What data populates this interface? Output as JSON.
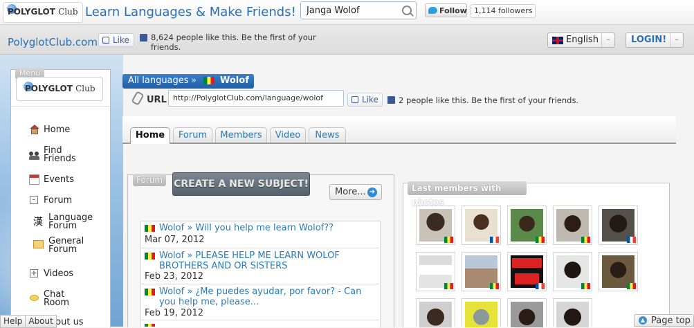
{
  "header": {
    "logo_text": "POLYGLOT",
    "logo_club": "Club",
    "tagline": "Learn Languages & Make Friends!",
    "search_value": "Janga Wolof",
    "follow_label": "Follow",
    "followers": "1,114 followers"
  },
  "subbar": {
    "site_name": "PolyglotClub.com",
    "like_label": "Like",
    "likes_text": "8,624 people like this. Be the first of your friends.",
    "language": "English",
    "login": "LOGIN!"
  },
  "menu": {
    "tab_label": "Menu",
    "logo_text": "POLYGLOT",
    "logo_club": "Club",
    "items": [
      {
        "label": "Home",
        "icon": "home-icon"
      },
      {
        "label": "Find Friends",
        "icon": "friends-icon"
      },
      {
        "label": "Events",
        "icon": "calendar-icon"
      },
      {
        "label": "Forum",
        "icon": "collapse-icon"
      },
      {
        "label": "Language Forum",
        "icon": "kanji-icon"
      },
      {
        "label": "General Forum",
        "icon": "forum-icon"
      },
      {
        "label": "Videos",
        "icon": "expand-icon"
      },
      {
        "label": "Chat Room",
        "icon": "chat-bubble-icon"
      },
      {
        "label": "About us",
        "icon": ""
      }
    ]
  },
  "breadcrumb": {
    "all": "All languages",
    "separator": "»",
    "current": "Wolof"
  },
  "url_row": {
    "label": "URL",
    "value": "http://PolyglotClub.com/language/wolof",
    "like_label": "Like",
    "likes_text": "2 people like this. Be the first of your friends."
  },
  "tabs": [
    "Home",
    "Forum",
    "Members",
    "Video",
    "News"
  ],
  "forum": {
    "tab_label": "Forum",
    "create_button": "CREATE A NEW SUBJECT!",
    "more_button": "More...",
    "posts": [
      {
        "title": "Wolof » Will you help me learn Wolof??",
        "date": "Mar 07, 2012"
      },
      {
        "title": "Wolof » PLEASE HELP ME LEARN WOLOF BROTHERS AND OR SISTERS",
        "date": "Feb 23, 2012"
      },
      {
        "title": "Wolof » ¿Me puedes ayudar, por favor? - Can you help me, please...",
        "date": "Feb 19, 2012"
      }
    ]
  },
  "members": {
    "tab_label": "Last members with photos"
  },
  "footer": {
    "help": "Help",
    "about": "About",
    "page_top": "Page top"
  },
  "colors": {
    "link_blue": "#2a7ab8",
    "breadcrumb_blue": "#1f5ea8",
    "create_button": "#55616c"
  }
}
